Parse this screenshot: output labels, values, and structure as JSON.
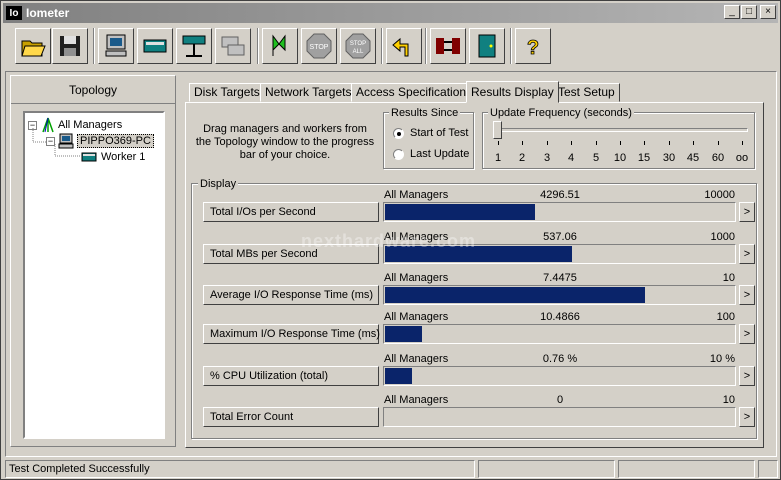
{
  "window": {
    "app_icon": "Io",
    "title": "Iometer",
    "min": "_",
    "max": "□",
    "close": "×"
  },
  "toolbar": {
    "buttons": [
      {
        "name": "open-config",
        "icon": "folder-open-icon"
      },
      {
        "name": "save-config",
        "icon": "floppy-disk-icon"
      },
      {
        "name": "start-new-manager",
        "icon": "computer-icon"
      },
      {
        "name": "start-disk-worker",
        "icon": "disk-worker-icon"
      },
      {
        "name": "start-network-worker",
        "icon": "network-worker-icon"
      },
      {
        "name": "duplicate-worker",
        "icon": "duplicate-icon"
      },
      {
        "name": "start-tests",
        "icon": "green-flag-icon"
      },
      {
        "name": "stop",
        "icon": "stop-sign-icon",
        "label": "STOP"
      },
      {
        "name": "stop-all",
        "icon": "stop-all-icon",
        "label": "STOP",
        "label2": "ALL"
      },
      {
        "name": "reset-workers",
        "icon": "reset-arrow-icon"
      },
      {
        "name": "disconnect",
        "icon": "disconnect-icon"
      },
      {
        "name": "exit",
        "icon": "exit-door-icon"
      },
      {
        "name": "about",
        "icon": "question-icon",
        "label": "?"
      }
    ]
  },
  "topology": {
    "header": "Topology",
    "nodes": [
      {
        "label": "All Managers",
        "toggle": "−"
      },
      {
        "label": "PIPPO369-PC",
        "toggle": "−"
      },
      {
        "label": "Worker 1"
      }
    ]
  },
  "tabs": [
    "Disk Targets",
    "Network Targets",
    "Access Specifications",
    "Results Display",
    "Test Setup"
  ],
  "results": {
    "hint": "Drag managers and workers from the Topology window to the progress bar of your choice.",
    "results_since": {
      "label": "Results Since",
      "options": [
        "Start of Test",
        "Last Update"
      ],
      "selected": "Start of Test"
    },
    "update_frequency": {
      "label": "Update Frequency (seconds)",
      "ticks": [
        "1",
        "2",
        "3",
        "4",
        "5",
        "10",
        "15",
        "30",
        "45",
        "60",
        "oo"
      ],
      "selected": "1"
    },
    "display_label": "Display",
    "arrow": ">",
    "rows": [
      {
        "button": "Total I/Os per Second",
        "manager": "All Managers",
        "value": "4296.51",
        "max": "10000",
        "fraction": 0.4297
      },
      {
        "button": "Total MBs per Second",
        "manager": "All Managers",
        "value": "537.06",
        "max": "1000",
        "fraction": 0.537
      },
      {
        "button": "Average I/O Response Time (ms)",
        "manager": "All Managers",
        "value": "7.4475",
        "max": "10",
        "fraction": 0.7448
      },
      {
        "button": "Maximum I/O Response Time (ms)",
        "manager": "All Managers",
        "value": "10.4866",
        "max": "100",
        "fraction": 0.1049
      },
      {
        "button": "% CPU Utilization (total)",
        "manager": "All Managers",
        "value": "0.76 %",
        "max": "10 %",
        "fraction": 0.076
      },
      {
        "button": "Total Error Count",
        "manager": "All Managers",
        "value": "0",
        "max": "10",
        "fraction": 0
      }
    ]
  },
  "status": {
    "text": "Test Completed Successfully"
  },
  "watermark": "nexthardware.com",
  "colors": {
    "bar_fill": "#0a246a",
    "face": "#d4d0c8",
    "title_gradient_start": "#808080"
  }
}
